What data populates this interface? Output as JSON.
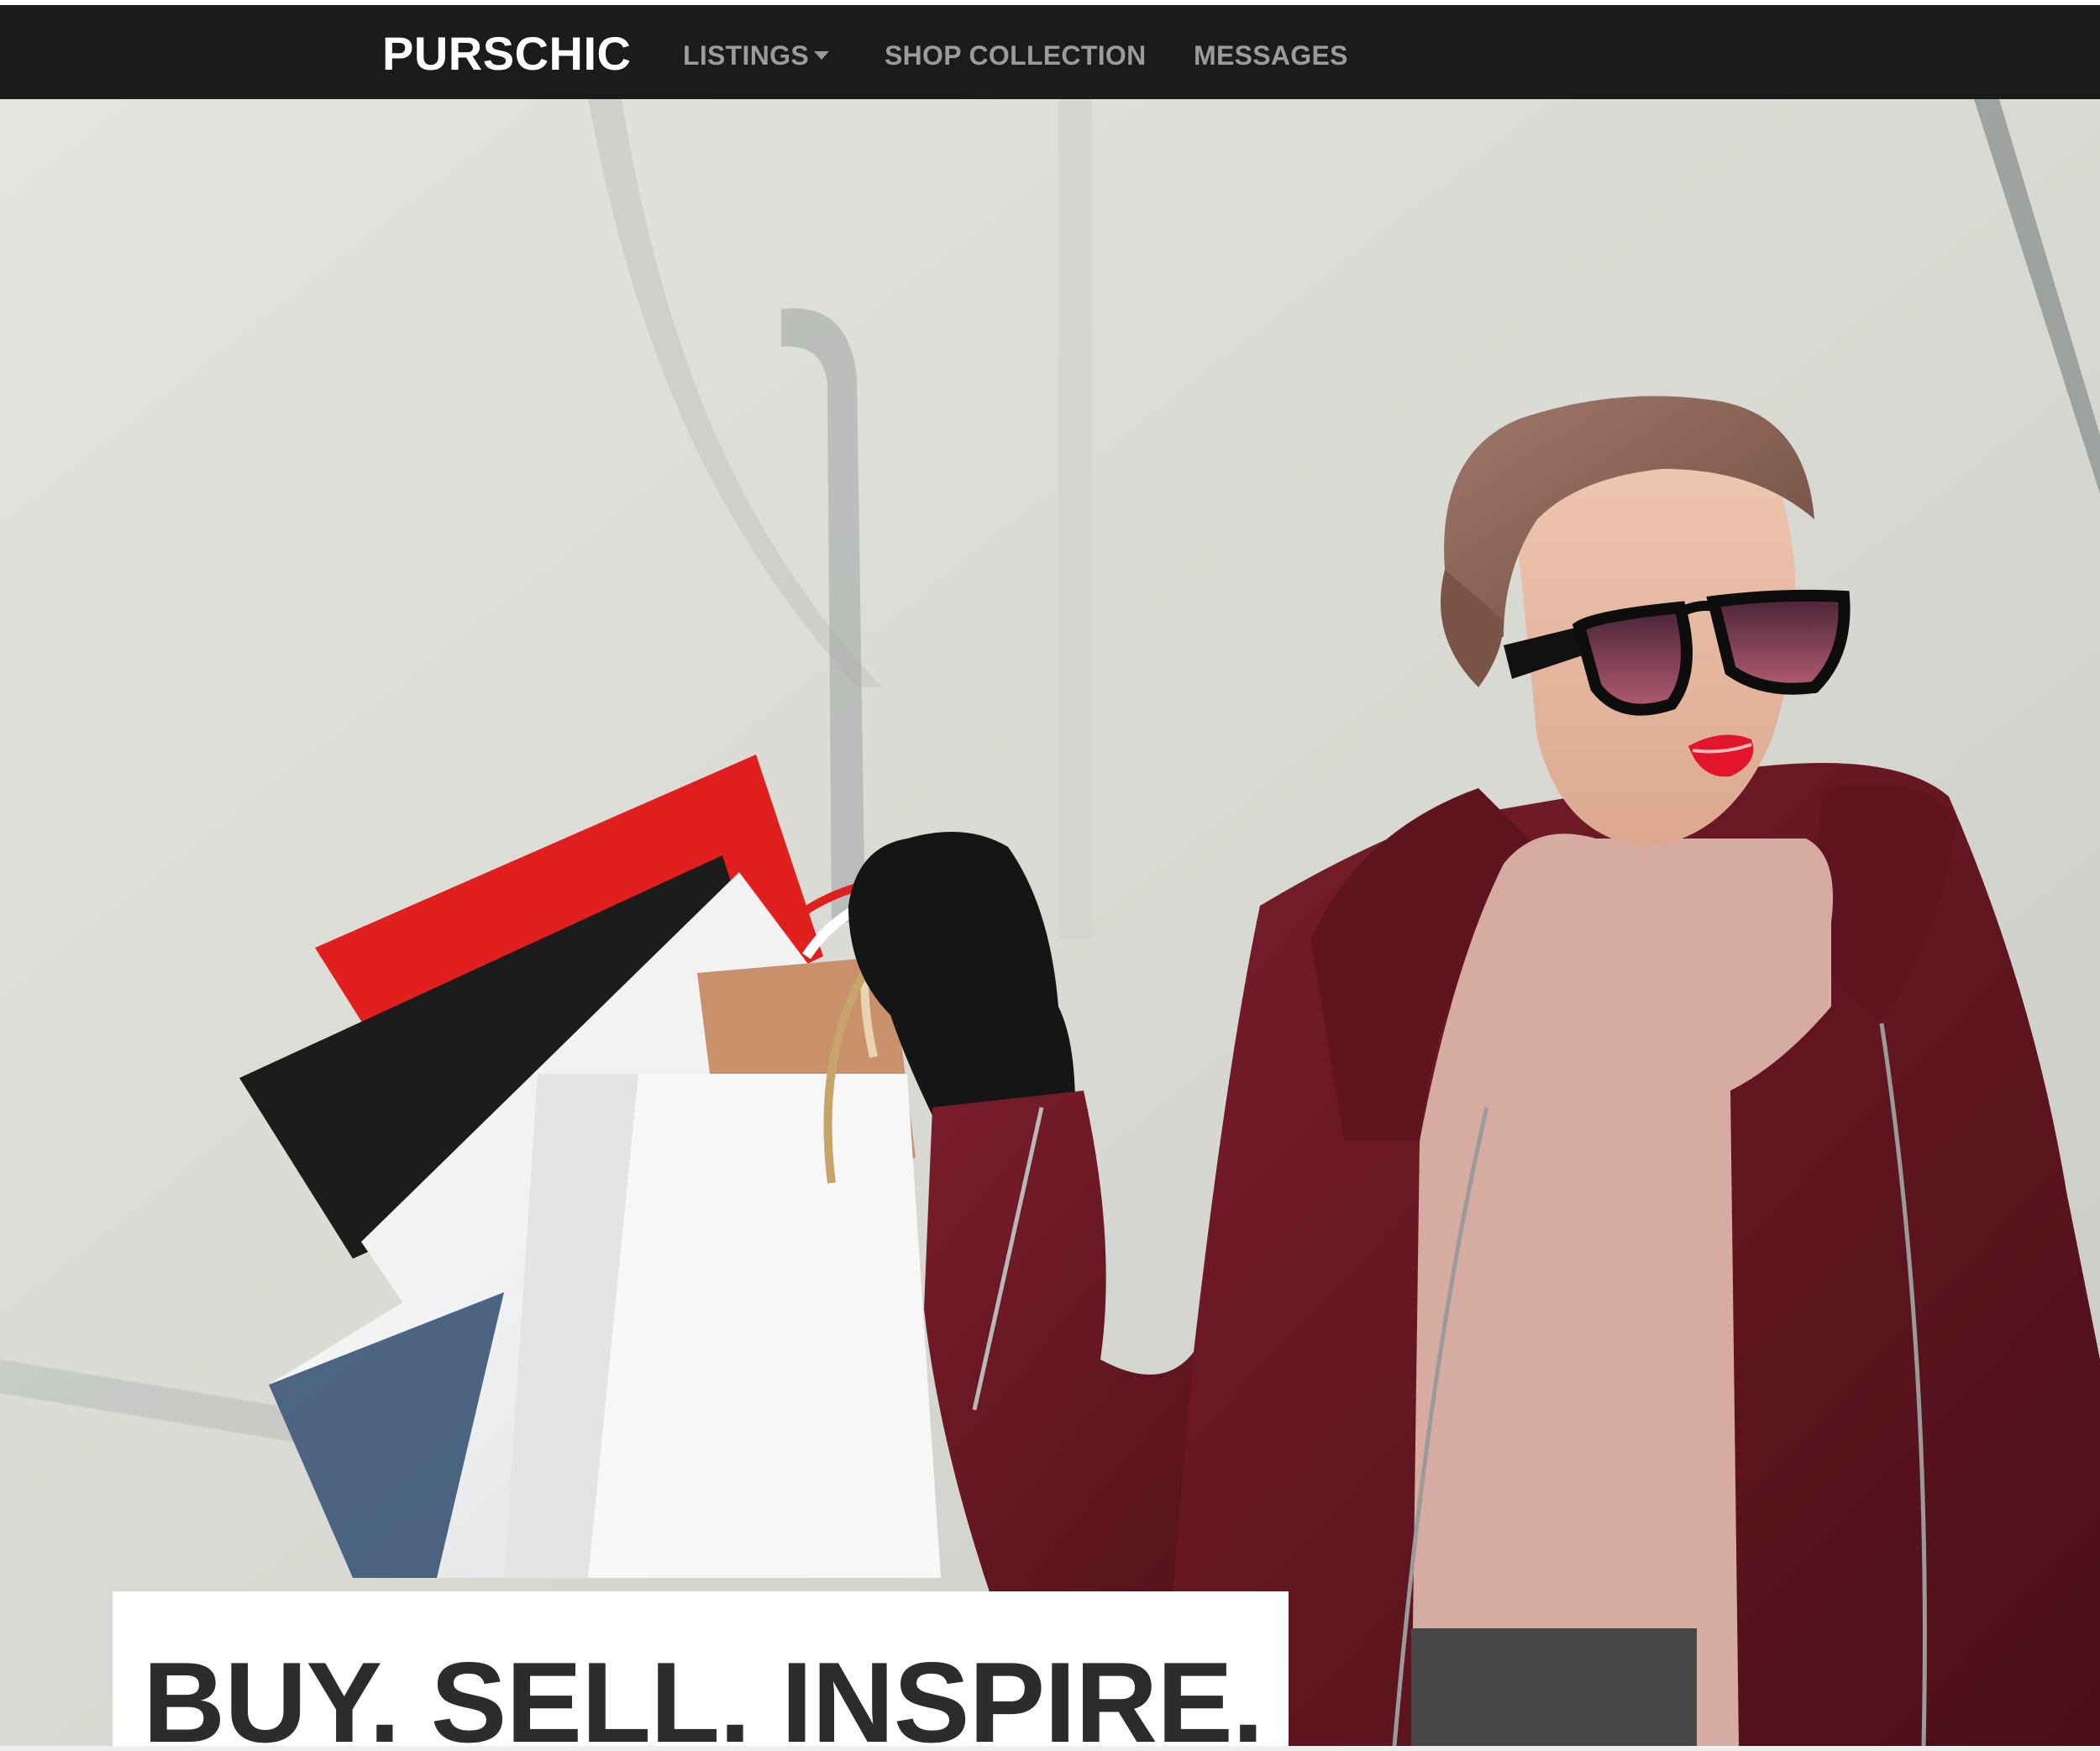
{
  "navbar": {
    "brand": "PURSCHIC",
    "links": [
      {
        "label": "LISTINGS",
        "has_dropdown": true
      },
      {
        "label": "SHOP COLLECTION",
        "has_dropdown": false
      },
      {
        "label": "MESSAGES",
        "has_dropdown": false
      }
    ],
    "background_color": "#1b1b1b",
    "link_color": "#9b9b9b",
    "brand_color": "#ffffff"
  },
  "hero": {
    "tagline": "BUY. SELL. INSPIRE.",
    "tagline_color": "#2c2c2c",
    "coat_color": "#6b1a24",
    "lip_color": "#e2152b"
  }
}
